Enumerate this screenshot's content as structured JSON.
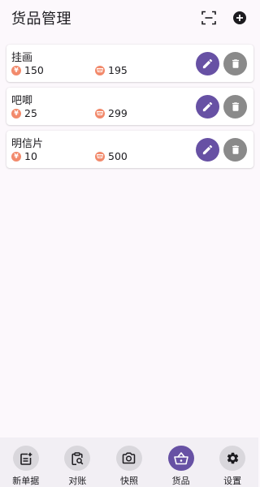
{
  "header": {
    "title": "货品管理"
  },
  "goods": [
    {
      "name": "挂画",
      "price": "150",
      "quantity": "195"
    },
    {
      "name": "吧唧",
      "price": "25",
      "quantity": "299"
    },
    {
      "name": "明信片",
      "price": "10",
      "quantity": "500"
    }
  ],
  "price_symbol": "¥",
  "bottom_nav": [
    {
      "label": "新单据",
      "icon": "new-document-icon"
    },
    {
      "label": "对账",
      "icon": "clipboard-search-icon"
    },
    {
      "label": "快照",
      "icon": "camera-icon"
    },
    {
      "label": "货品",
      "icon": "basket-icon",
      "active": true
    },
    {
      "label": "设置",
      "icon": "gear-icon"
    }
  ],
  "colors": {
    "accent": "#6751A4",
    "delete": "#8A8A8A",
    "badge": "#F28A6C",
    "background": "#FCF8FC",
    "nav_background": "#F2EFF4"
  }
}
